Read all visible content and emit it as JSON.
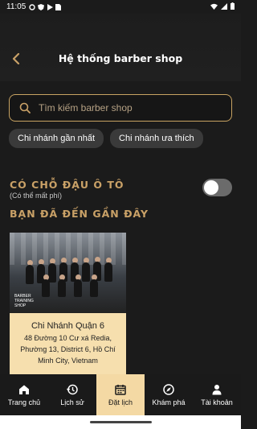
{
  "status_bar": {
    "time": "11:05",
    "icons": [
      "settings-icon",
      "shield-icon",
      "play-icon",
      "sim-icon"
    ],
    "system_icons": [
      "wifi-icon",
      "signal-icon",
      "battery-icon"
    ]
  },
  "header": {
    "title": "Hệ thống barber shop",
    "back_icon": "chevron-left-icon"
  },
  "search": {
    "placeholder": "Tìm kiếm barber shop"
  },
  "chips": [
    {
      "label": "Chi nhánh gần nhất"
    },
    {
      "label": "Chi nhánh ưa thích"
    }
  ],
  "parking": {
    "label": "CÓ CHỖ ĐẬU Ô TÔ",
    "sub": "(Có thể mất phí)",
    "enabled": false
  },
  "recent": {
    "title": "BẠN ĐÃ ĐẾN GẦN ĐÂY",
    "cards": [
      {
        "name": "Chi Nhánh Quận 6",
        "address": "48 Đường 10 Cư xá Redia, Phường 13, District 6, Hồ Chí Minh City, Vietnam",
        "photo_caption": "BARBER TRAINING SHOP"
      }
    ]
  },
  "nav": [
    {
      "label": "Trang chủ",
      "icon": "home-icon",
      "active": false
    },
    {
      "label": "Lịch sử",
      "icon": "history-icon",
      "active": false
    },
    {
      "label": "Đặt lịch",
      "icon": "calendar-icon",
      "active": true
    },
    {
      "label": "Khám phá",
      "icon": "compass-icon",
      "active": false
    },
    {
      "label": "Tài khoản",
      "icon": "user-icon",
      "active": false
    }
  ],
  "colors": {
    "background": "#1b1b1b",
    "accent": "#c9a167",
    "card_info": "#f6dfae",
    "nav_active": "#f4d9a4"
  }
}
